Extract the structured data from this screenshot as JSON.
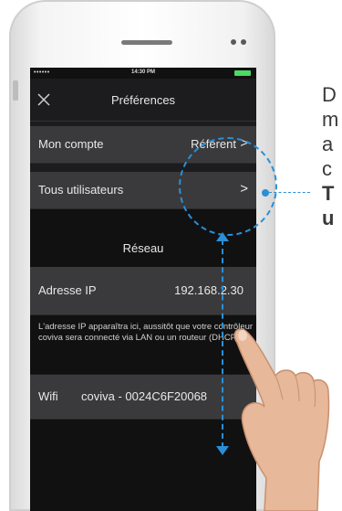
{
  "status": {
    "signal": "••••••",
    "time": "14:30 PM"
  },
  "nav": {
    "title": "Préférences"
  },
  "rows": {
    "account": {
      "label": "Mon compte",
      "value": "Référent",
      "chevron": ">"
    },
    "users": {
      "label": "Tous utilisateurs",
      "chevron": ">"
    }
  },
  "network": {
    "section_title": "Réseau",
    "ip": {
      "label": "Adresse IP",
      "value": "192.168.2.30"
    },
    "note": "L'adresse IP apparaîtra ici, aussitôt que votre contrôleur coviva sera connecté via LAN ou un routeur (DHCP)",
    "wifi": {
      "label": "Wifi",
      "value": "coviva - 0024C6F20068"
    }
  },
  "side_text": {
    "lines": [
      "D",
      "m",
      "a",
      "c"
    ],
    "bold_lines": [
      "T",
      "u"
    ]
  },
  "colors": {
    "accent": "#2a8fd6",
    "screen_bg": "#1c1c1e",
    "row_bg": "#3a3a3c"
  }
}
